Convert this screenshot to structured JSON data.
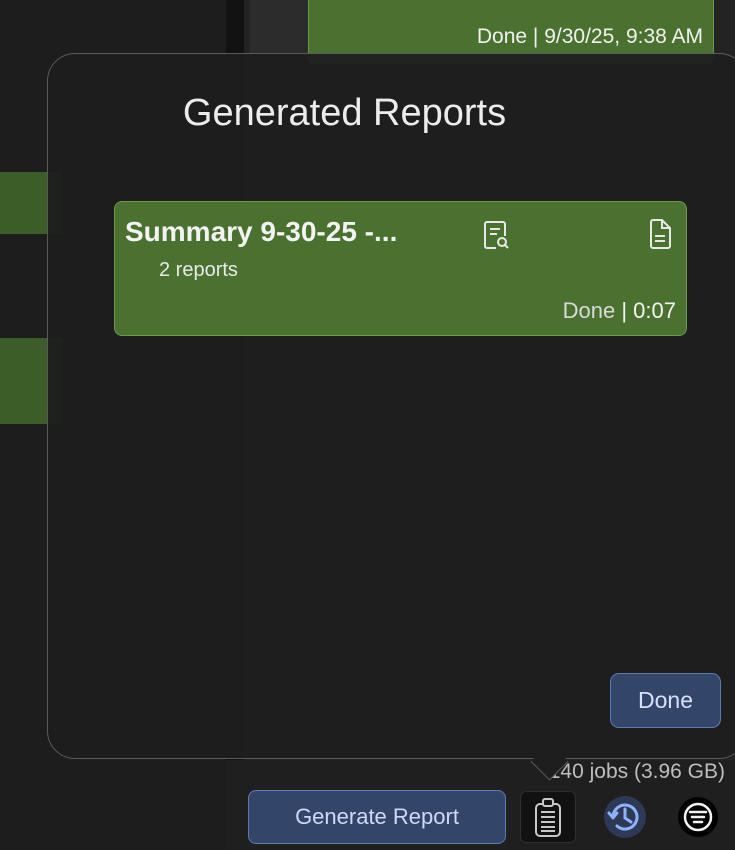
{
  "background": {
    "job_status": "Done | 9/30/25, 9:38 AM"
  },
  "popover": {
    "title": "Generated Reports",
    "reports": [
      {
        "title": "Summary 9-30-25 -...",
        "subtitle": "2 reports",
        "status": "Done",
        "separator": "|",
        "duration": "0:07",
        "icons": [
          "report-preview-icon",
          "document-icon"
        ]
      }
    ],
    "done_label": "Done"
  },
  "footer": {
    "jobs_summary": "140 jobs (3.96 GB)",
    "generate_label": "Generate Report",
    "icons": [
      "reports-list-icon",
      "history-icon",
      "filter-icon"
    ]
  },
  "colors": {
    "card_green": "#4b7130",
    "button_blue": "#34456a",
    "button_border": "#5f78ad"
  }
}
